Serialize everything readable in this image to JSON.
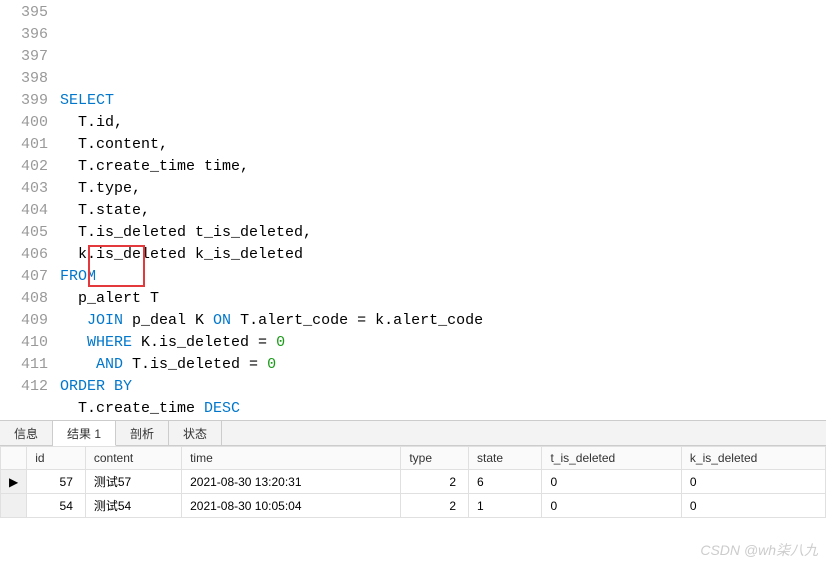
{
  "code_lines": [
    {
      "n": 395,
      "tokens": []
    },
    {
      "n": 396,
      "tokens": [
        {
          "t": "SELECT",
          "c": "kw"
        }
      ]
    },
    {
      "n": 397,
      "tokens": [
        {
          "t": "  T.id,"
        }
      ]
    },
    {
      "n": 398,
      "tokens": [
        {
          "t": "  T.content,"
        }
      ]
    },
    {
      "n": 399,
      "tokens": [
        {
          "t": "  T.create_time time,"
        }
      ]
    },
    {
      "n": 400,
      "tokens": [
        {
          "t": "  T.type,"
        }
      ]
    },
    {
      "n": 401,
      "tokens": [
        {
          "t": "  T.state,"
        }
      ]
    },
    {
      "n": 402,
      "tokens": [
        {
          "t": "  T.is_deleted t_is_deleted,"
        }
      ]
    },
    {
      "n": 403,
      "tokens": [
        {
          "t": "  k.is_deleted k_is_deleted"
        }
      ]
    },
    {
      "n": 404,
      "tokens": [
        {
          "t": "FROM",
          "c": "kw"
        }
      ]
    },
    {
      "n": 405,
      "tokens": [
        {
          "t": "  p_alert T"
        }
      ]
    },
    {
      "n": 406,
      "tokens": [
        {
          "t": "   "
        },
        {
          "t": "JOIN",
          "c": "kw"
        },
        {
          "t": " p_deal K "
        },
        {
          "t": "ON",
          "c": "kw"
        },
        {
          "t": " T.alert_code = k.alert_code"
        }
      ]
    },
    {
      "n": 407,
      "tokens": [
        {
          "t": "   "
        },
        {
          "t": "WHERE",
          "c": "kw"
        },
        {
          "t": " K.is_deleted = "
        },
        {
          "t": "0",
          "c": "num"
        }
      ]
    },
    {
      "n": 408,
      "tokens": [
        {
          "t": "    "
        },
        {
          "t": "AND",
          "c": "kw"
        },
        {
          "t": " T.is_deleted = "
        },
        {
          "t": "0",
          "c": "num"
        }
      ]
    },
    {
      "n": 409,
      "tokens": [
        {
          "t": "ORDER BY",
          "c": "kw"
        }
      ]
    },
    {
      "n": 410,
      "tokens": [
        {
          "t": "  T.create_time "
        },
        {
          "t": "DESC",
          "c": "kw"
        }
      ]
    },
    {
      "n": 411,
      "tokens": []
    },
    {
      "n": 412,
      "tokens": []
    }
  ],
  "tabs": {
    "info": "信息",
    "result1": "结果 1",
    "analyze": "剖析",
    "status": "状态"
  },
  "result": {
    "columns": [
      "id",
      "content",
      "time",
      "type",
      "state",
      "t_is_deleted",
      "k_is_deleted"
    ],
    "rows": [
      {
        "marker": "▶",
        "cells": [
          "57",
          "测试57",
          "2021-08-30 13:20:31",
          "2",
          "6",
          "0",
          "0"
        ]
      },
      {
        "marker": "",
        "cells": [
          "54",
          "测试54",
          "2021-08-30 10:05:04",
          "2",
          "1",
          "0",
          "0"
        ]
      }
    ]
  },
  "watermark": "CSDN @wh柒八九"
}
